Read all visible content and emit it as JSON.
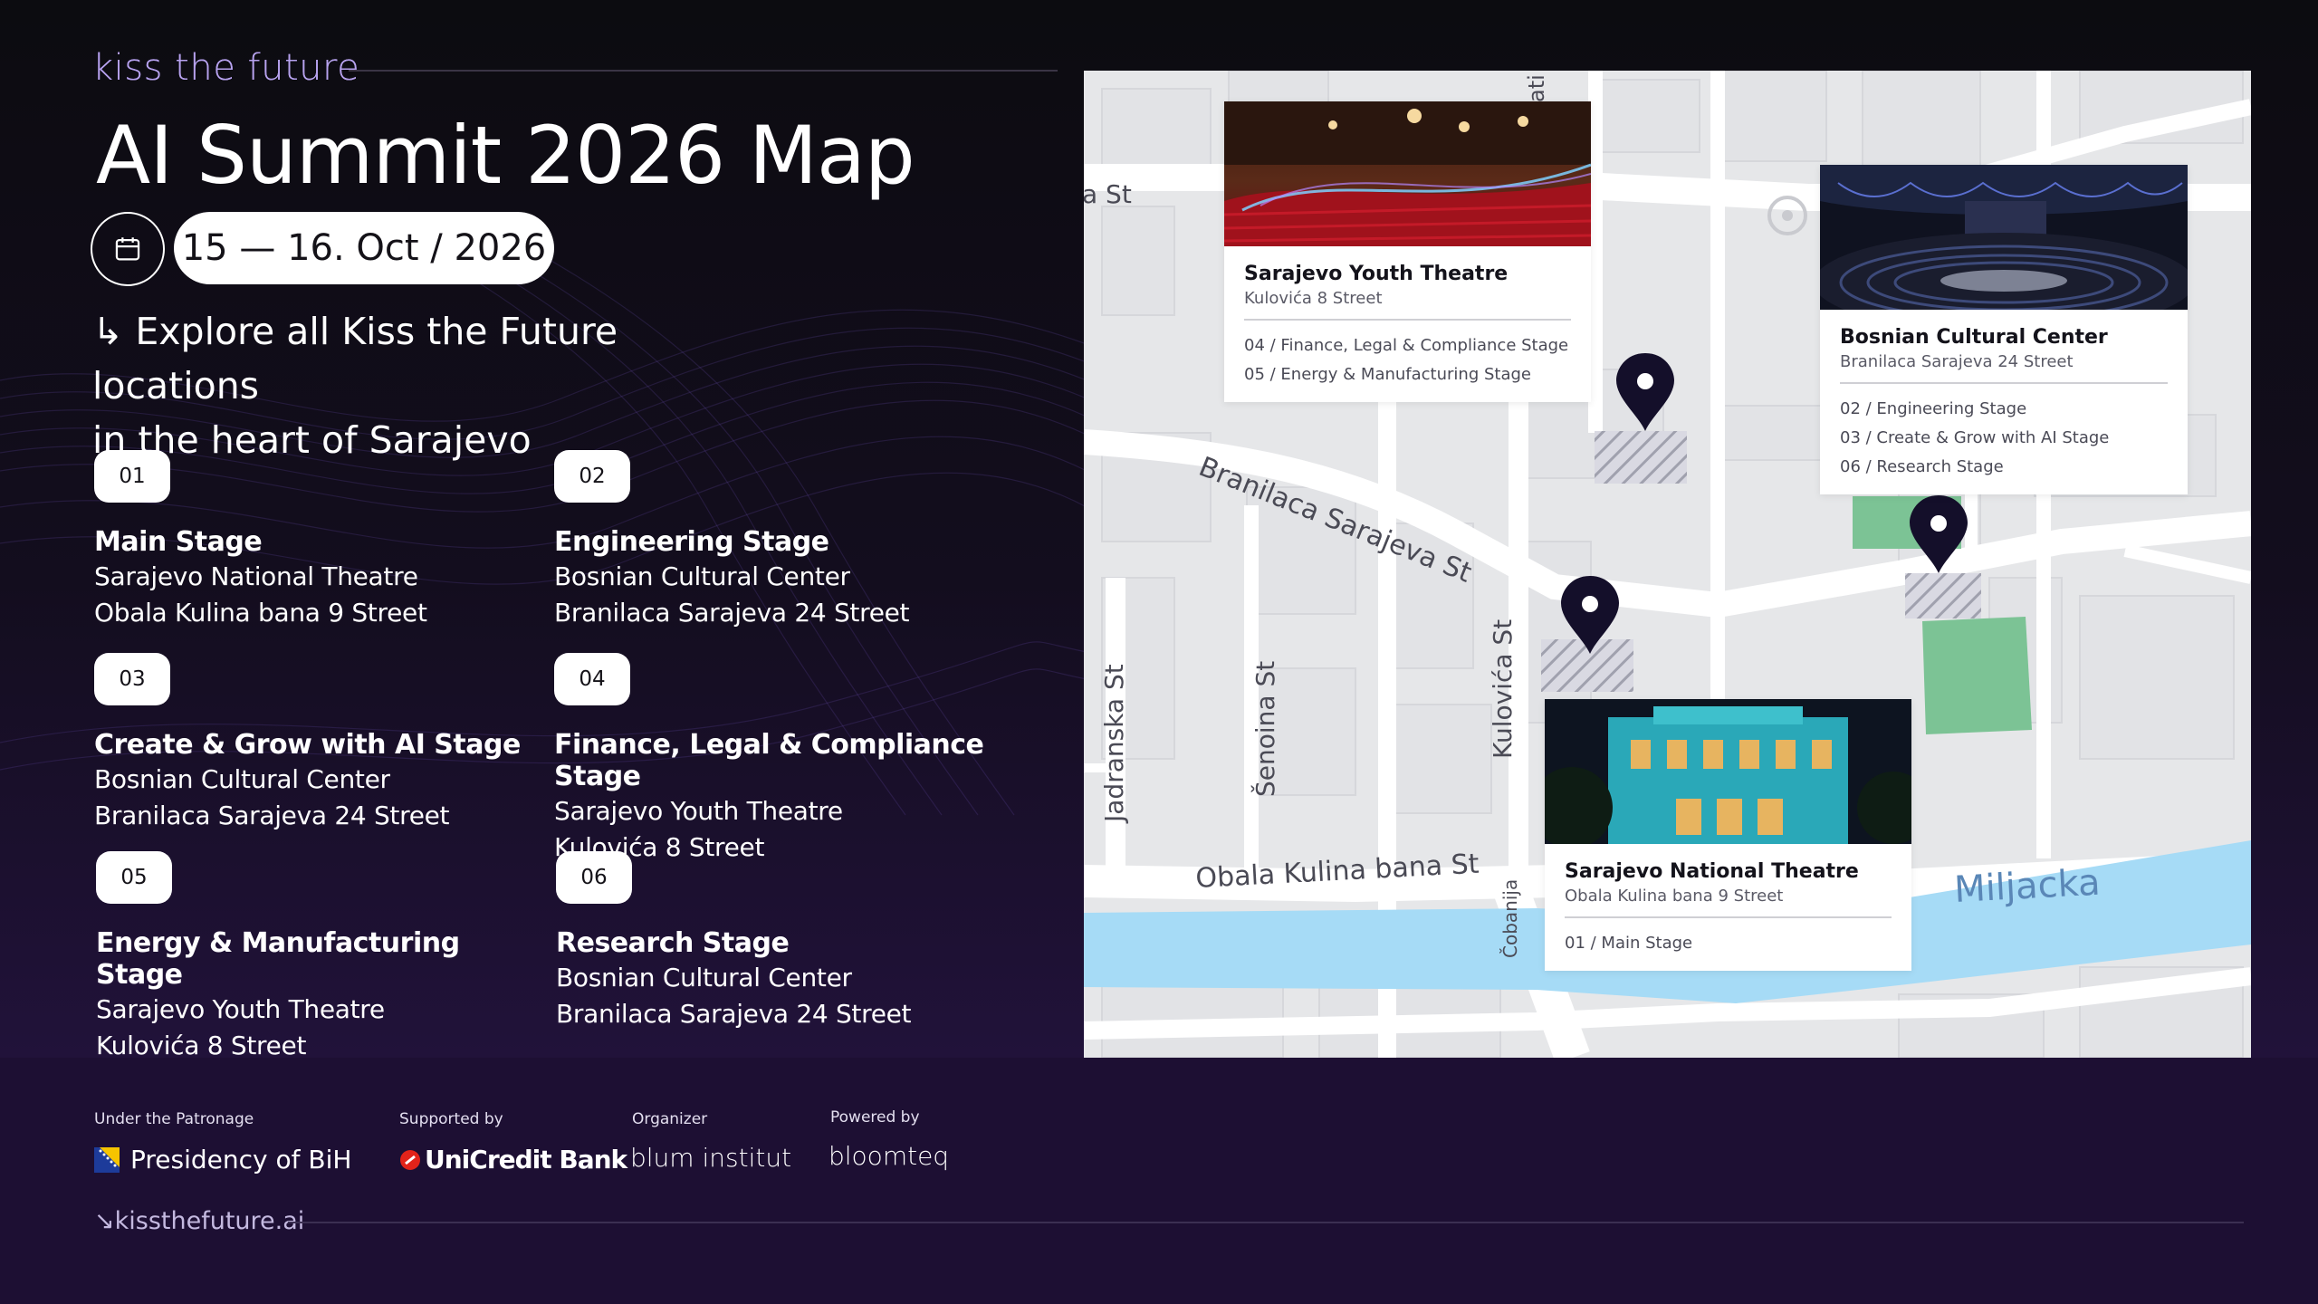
{
  "brand": "kiss the future",
  "title": "AI Summit 2026 Map",
  "date": "15 — 16. Oct / 2026",
  "intro_line1": "↳ Explore all Kiss the Future locations",
  "intro_line2": "in the heart of Sarajevo",
  "stages": [
    {
      "num": "01",
      "name": "Main Stage",
      "venue": "Sarajevo National Theatre",
      "address": "Obala Kulina bana 9 Street"
    },
    {
      "num": "02",
      "name": "Engineering Stage",
      "venue": "Bosnian Cultural Center",
      "address": "Branilaca Sarajeva 24 Street"
    },
    {
      "num": "03",
      "name": "Create & Grow with AI Stage",
      "venue": "Bosnian Cultural Center",
      "address": "Branilaca Sarajeva 24 Street"
    },
    {
      "num": "04",
      "name": "Finance, Legal & Compliance Stage",
      "venue": "Sarajevo Youth Theatre",
      "address": "Kulovića 8 Street"
    },
    {
      "num": "05",
      "name": "Energy & Manufacturing Stage",
      "venue": "Sarajevo Youth Theatre",
      "address": "Kulovića 8 Street"
    },
    {
      "num": "06",
      "name": "Research  Stage",
      "venue": "Bosnian Cultural Center",
      "address": "Branilaca Sarajeva 24 Street"
    }
  ],
  "map": {
    "streets": {
      "top": "a St",
      "branilaca": "Branilaca Sarajeva St",
      "jadranska": "Jadranska St",
      "senoina": "Šenoina St",
      "kulovica": "Kulovića St",
      "obala": "Obala Kulina bana St",
      "cobanija": "Čobanija",
      "river": "Miljacka",
      "top_vertical": "ati"
    },
    "cards": {
      "youth": {
        "name": "Sarajevo Youth Theatre",
        "address": "Kulovića 8 Street",
        "stages": [
          "04 / Finance, Legal & Compliance Stage",
          "05 / Energy & Manufacturing Stage"
        ]
      },
      "bkc": {
        "name": "Bosnian Cultural Center",
        "address": "Branilaca Sarajeva 24 Street",
        "stages": [
          "02 / Engineering Stage",
          "03 / Create & Grow with AI Stage",
          "06 / Research Stage"
        ]
      },
      "national": {
        "name": "Sarajevo National Theatre",
        "address": "Obala Kulina bana 9 Street",
        "stages": [
          "01 / Main Stage"
        ]
      }
    },
    "colors": {
      "water": "#a6dbf6",
      "park": "#7cc395",
      "pin": "#140f2a",
      "road": "#ffffff",
      "block": "#e6e7e9"
    }
  },
  "footer": {
    "patronage_label": "Under the Patronage",
    "patronage_value": "Presidency of BiH",
    "supported_label": "Supported by",
    "supported_value": "UniCredit Bank",
    "organizer_label": "Organizer",
    "organizer_value": "blum institut",
    "powered_label": "Powered by",
    "powered_value": "bloomteq",
    "site": "↘kissthefuture.ai"
  }
}
